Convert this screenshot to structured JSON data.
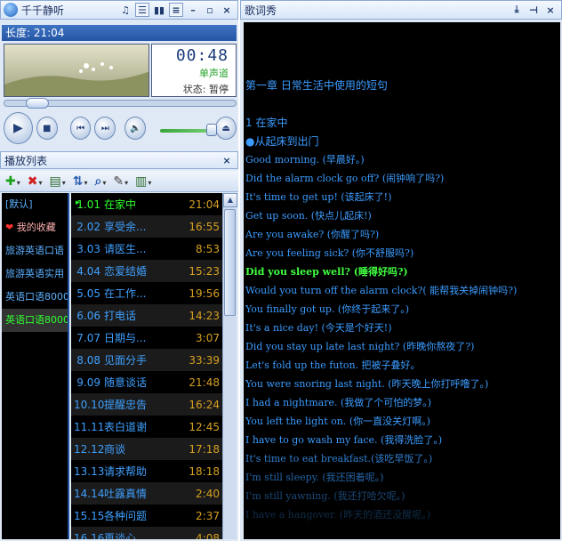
{
  "player": {
    "title": "千千静听",
    "length_label": "长度:  21:04",
    "clock": "00:48",
    "channel": "单声道",
    "status": "状态:  暂停",
    "seek_fraction": 0.1,
    "volume_fraction": 0.9
  },
  "playlist": {
    "title": "播放列表",
    "lists": [
      "[默认]",
      "我的收藏",
      "旅游英语口语",
      "旅游英语实用",
      "英语口语8000",
      "英语口语8000"
    ],
    "tracks": [
      {
        "num": "1.01",
        "name": "在家中",
        "dur": "21:04"
      },
      {
        "num": "2.02",
        "name": "享受余...",
        "dur": "16:55"
      },
      {
        "num": "3.03",
        "name": "请医生...",
        "dur": "8:53"
      },
      {
        "num": "4.04",
        "name": "恋爱结婚",
        "dur": "15:23"
      },
      {
        "num": "5.05",
        "name": "在工作...",
        "dur": "19:56"
      },
      {
        "num": "6.06",
        "name": "打电话",
        "dur": "14:23"
      },
      {
        "num": "7.07",
        "name": "日期与...",
        "dur": "3:07"
      },
      {
        "num": "8.08",
        "name": "见面分手",
        "dur": "33:39"
      },
      {
        "num": "9.09",
        "name": "随意谈话",
        "dur": "21:48"
      },
      {
        "num": "10.10",
        "name": "提醒忠告",
        "dur": "16:24"
      },
      {
        "num": "11.11",
        "name": "表白道谢",
        "dur": "12:45"
      },
      {
        "num": "12.12",
        "name": "商谈",
        "dur": "17:18"
      },
      {
        "num": "13.13",
        "name": "请求帮助",
        "dur": "18:18"
      },
      {
        "num": "14.14",
        "name": "吐露真情",
        "dur": "2:40"
      },
      {
        "num": "15.15",
        "name": "各种问题",
        "dur": "2:37"
      },
      {
        "num": "16.16",
        "name": "再谈心",
        "dur": "4:08"
      }
    ]
  },
  "lyrics": {
    "title": "歌词秀",
    "lines": [
      "第一章 日常生活中使用的短句",
      "1  在家中",
      "●从起床到出门",
      "Good morning. (早晨好。)",
      "Did the alarm clock go off? (闹钟响了吗?)",
      "It's time to get up! (该起床了!)",
      "Get up soon. (快点儿起床!)",
      "Are you awake? (你醒了吗?)",
      "Are you feeling sick? (你不舒服吗?)",
      "Did you sleep well? (睡得好吗?)",
      "Would you turn off the alarm clock?( 能帮我关掉闹钟吗?)",
      "You finally got up. (你终于起来了。)",
      "It's a nice day! (今天是个好天!)",
      "Did you stay up late last night? (昨晚你熬夜了?)",
      "Let's fold up the futon. 把被子叠好。",
      "You were snoring last night. (昨天晚上你打呼噜了。)",
      "I had a nightmare. (我做了个可怕的梦。)",
      "You left the light on. (你一直没关灯啊。)",
      "I have to go wash my face. (我得洗脸了。)",
      "It's time to eat breakfast.(该吃早饭了。)",
      "I'm still sleepy. (我还困着呢。)",
      "I'm still yawning. (我还打哈欠呢。)",
      "I have a hangover. (昨天的酒还没醒呢。)"
    ]
  }
}
